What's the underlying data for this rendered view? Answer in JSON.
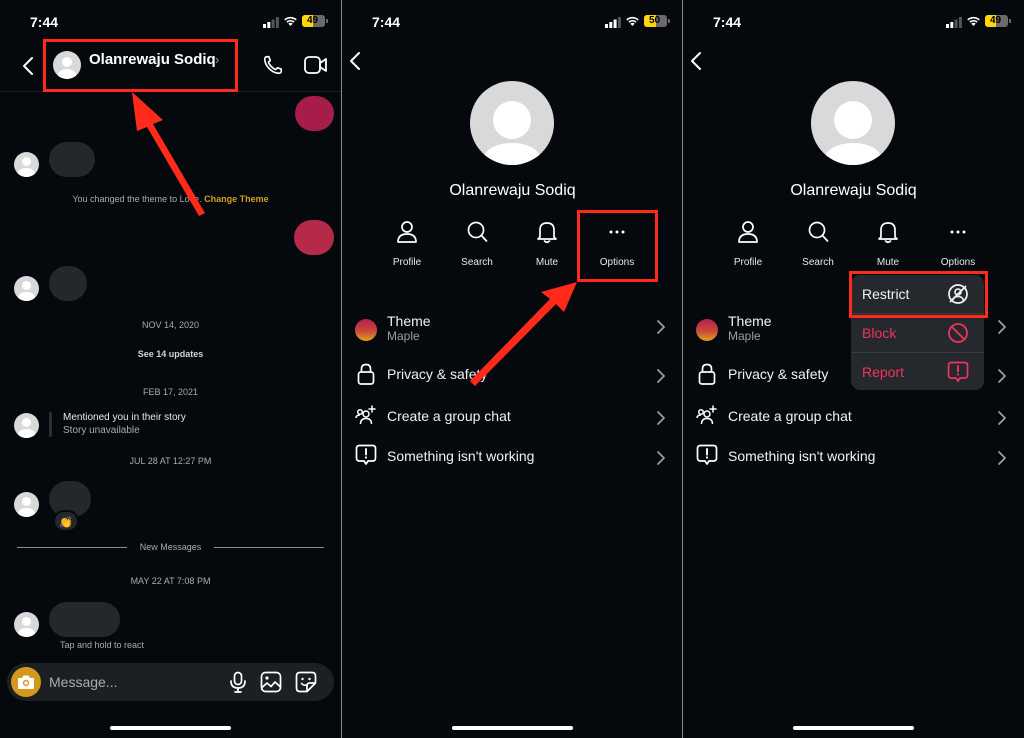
{
  "status_bars": [
    {
      "time": "7:44",
      "battery": "49",
      "battery_level_percent": 49
    },
    {
      "time": "7:44",
      "battery": "50",
      "battery_level_percent": 50
    },
    {
      "time": "7:44",
      "battery": "49",
      "battery_level_percent": 49
    }
  ],
  "chat": {
    "contact_name": "Olanrewaju Sodiq",
    "header_chevron": "›",
    "theme_notice": "You changed the theme to Love.",
    "theme_notice_link": "Change Theme",
    "date_1": "NOV 14, 2020",
    "see_updates": "See 14 updates",
    "date_2": "FEB 17, 2021",
    "mention_title": "Mentioned you in their story",
    "mention_sub": "Story unavailable",
    "date_3": "JUL 28 AT 12:27 PM",
    "reaction_emoji": "👏",
    "new_messages": "New Messages",
    "date_4": "MAY 22 AT 7:08 PM",
    "hint": "Tap and hold to react",
    "composer_placeholder": "Message...",
    "colors": {
      "accent": "#d2a21c",
      "outgoing_bubble": "#a71d4a",
      "outgoing_bubble_2": "#b52a48",
      "camera": "#d19a1d"
    }
  },
  "profile": {
    "name": "Olanrewaju Sodiq",
    "actions": [
      {
        "label": "Profile",
        "icon": "person-icon"
      },
      {
        "label": "Search",
        "icon": "search-icon"
      },
      {
        "label": "Mute",
        "icon": "bell-icon"
      },
      {
        "label": "Options",
        "icon": "more-icon"
      }
    ],
    "rows": [
      {
        "title": "Theme",
        "sub": "Maple",
        "icon": "theme-icon"
      },
      {
        "title": "Privacy & safety",
        "icon": "lock-icon"
      },
      {
        "title": "Create a group chat",
        "icon": "add-group-icon"
      },
      {
        "title": "Something isn't working",
        "icon": "report-icon"
      }
    ]
  },
  "options_menu": {
    "items": [
      {
        "label": "Restrict",
        "icon": "restrict-icon",
        "color": "#f2f2f2"
      },
      {
        "label": "Block",
        "icon": "block-icon",
        "color": "#f0335f"
      },
      {
        "label": "Report",
        "icon": "report-icon",
        "color": "#f0335f"
      }
    ]
  },
  "annotation_color": "#ff2a1a"
}
